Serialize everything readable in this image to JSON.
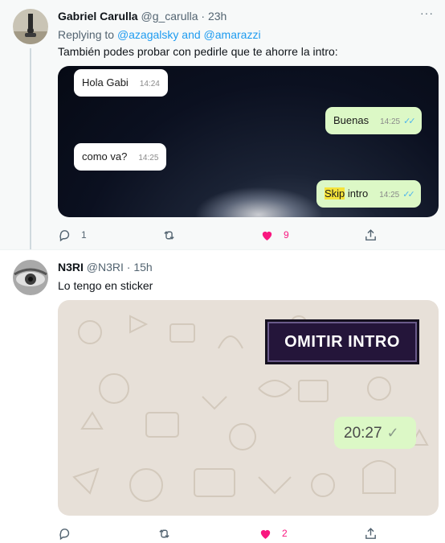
{
  "tweet1": {
    "name": "Gabriel Carulla",
    "handle": "@g_carulla",
    "dot": "·",
    "time": "23h",
    "more": "···",
    "replying_prefix": "Replying to",
    "mention1": "@azagalsky",
    "and": "and",
    "mention2": "@amarazzi",
    "text": "También podes probar con pedirle que te ahorre la intro:",
    "chat": [
      {
        "text": "Hola Gabi",
        "time": "14:24"
      },
      {
        "text": "Buenas",
        "time": "14:25"
      },
      {
        "text": "como va?",
        "time": "14:25"
      },
      {
        "text_highlight": "Skip",
        "text_rest": " intro",
        "time": "14:25"
      }
    ],
    "reply_count": "1",
    "like_count": "9"
  },
  "tweet2": {
    "name": "N3RI",
    "handle": "@N3RI",
    "dot": "·",
    "time": "15h",
    "text": "Lo tengo en sticker",
    "sticker_text": "OMITIR INTRO",
    "message_time": "20:27",
    "like_count": "2"
  },
  "colors": {
    "accent": "#1d9bf0",
    "like": "#f91880",
    "muted": "#536471",
    "whatsapp_out": "#dcf8c6"
  }
}
